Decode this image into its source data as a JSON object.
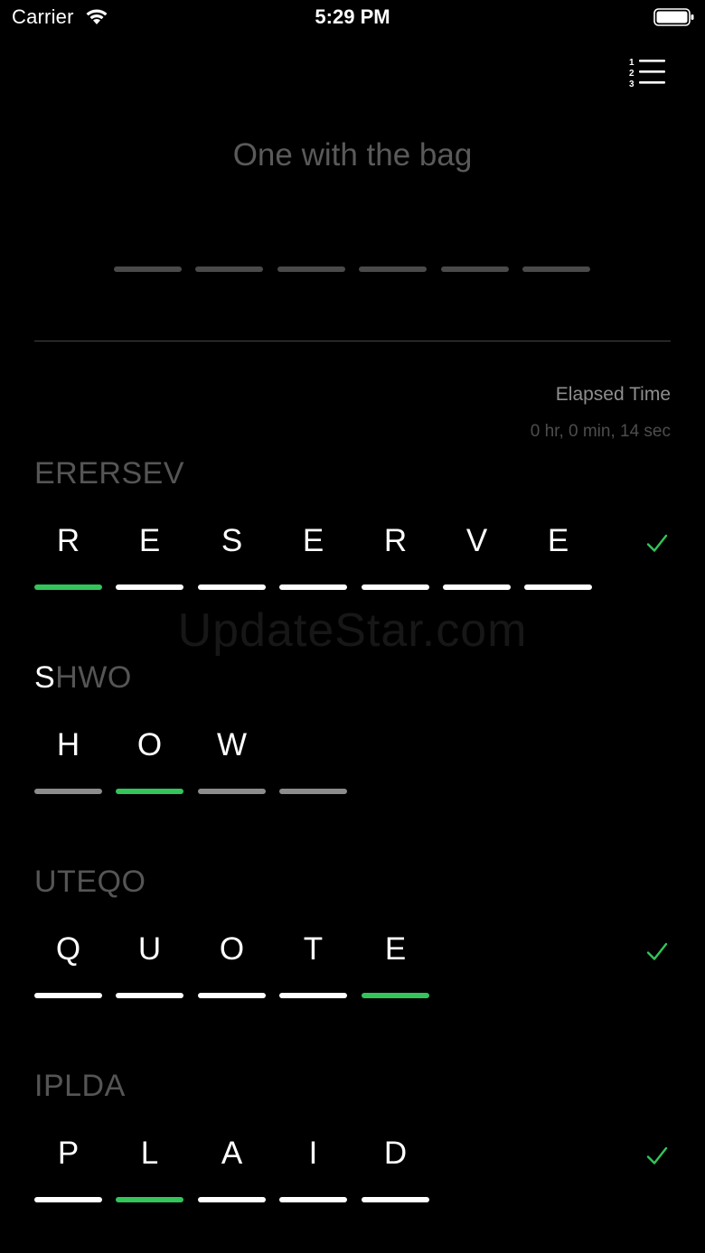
{
  "status_bar": {
    "carrier": "Carrier",
    "time": "5:29 PM",
    "wifi_icon": "wifi-icon",
    "battery_icon": "battery-icon"
  },
  "toolbar": {
    "ranking_icon": "numbered-list-icon"
  },
  "clue": {
    "text": "One with the bag",
    "slot_count": 6,
    "slot_color": "#4a4a4a"
  },
  "timer": {
    "label": "Elapsed Time",
    "value": "0 hr, 0 min, 14 sec"
  },
  "watermark": "UpdateStar.com",
  "colors": {
    "background": "#000000",
    "accent_green": "#33c45a",
    "completed_bar": "#ffffff",
    "pending_bar": "#8c8c8c",
    "scramble_text": "#555555"
  },
  "words": [
    {
      "scramble": "ERERSEV",
      "highlighted_prefix": "",
      "letters": [
        "R",
        "E",
        "S",
        "E",
        "R",
        "V",
        "E"
      ],
      "total_slots": 7,
      "bars": [
        "green",
        "white",
        "white",
        "white",
        "white",
        "white",
        "white"
      ],
      "solved": true,
      "check_icon": "checkmark-icon"
    },
    {
      "scramble": "SHWO",
      "highlighted_prefix": "S",
      "letters": [
        "H",
        "O",
        "W"
      ],
      "total_slots": 4,
      "bars": [
        "gray",
        "green",
        "gray",
        "gray"
      ],
      "solved": false
    },
    {
      "scramble": "UTEQO",
      "highlighted_prefix": "",
      "letters": [
        "Q",
        "U",
        "O",
        "T",
        "E"
      ],
      "total_slots": 5,
      "bars": [
        "white",
        "white",
        "white",
        "white",
        "green"
      ],
      "solved": true,
      "check_icon": "checkmark-icon"
    },
    {
      "scramble": "IPLDA",
      "highlighted_prefix": "",
      "letters": [
        "P",
        "L",
        "A",
        "I",
        "D"
      ],
      "total_slots": 5,
      "bars": [
        "white",
        "green",
        "white",
        "white",
        "white"
      ],
      "solved": true,
      "check_icon": "checkmark-icon"
    }
  ]
}
